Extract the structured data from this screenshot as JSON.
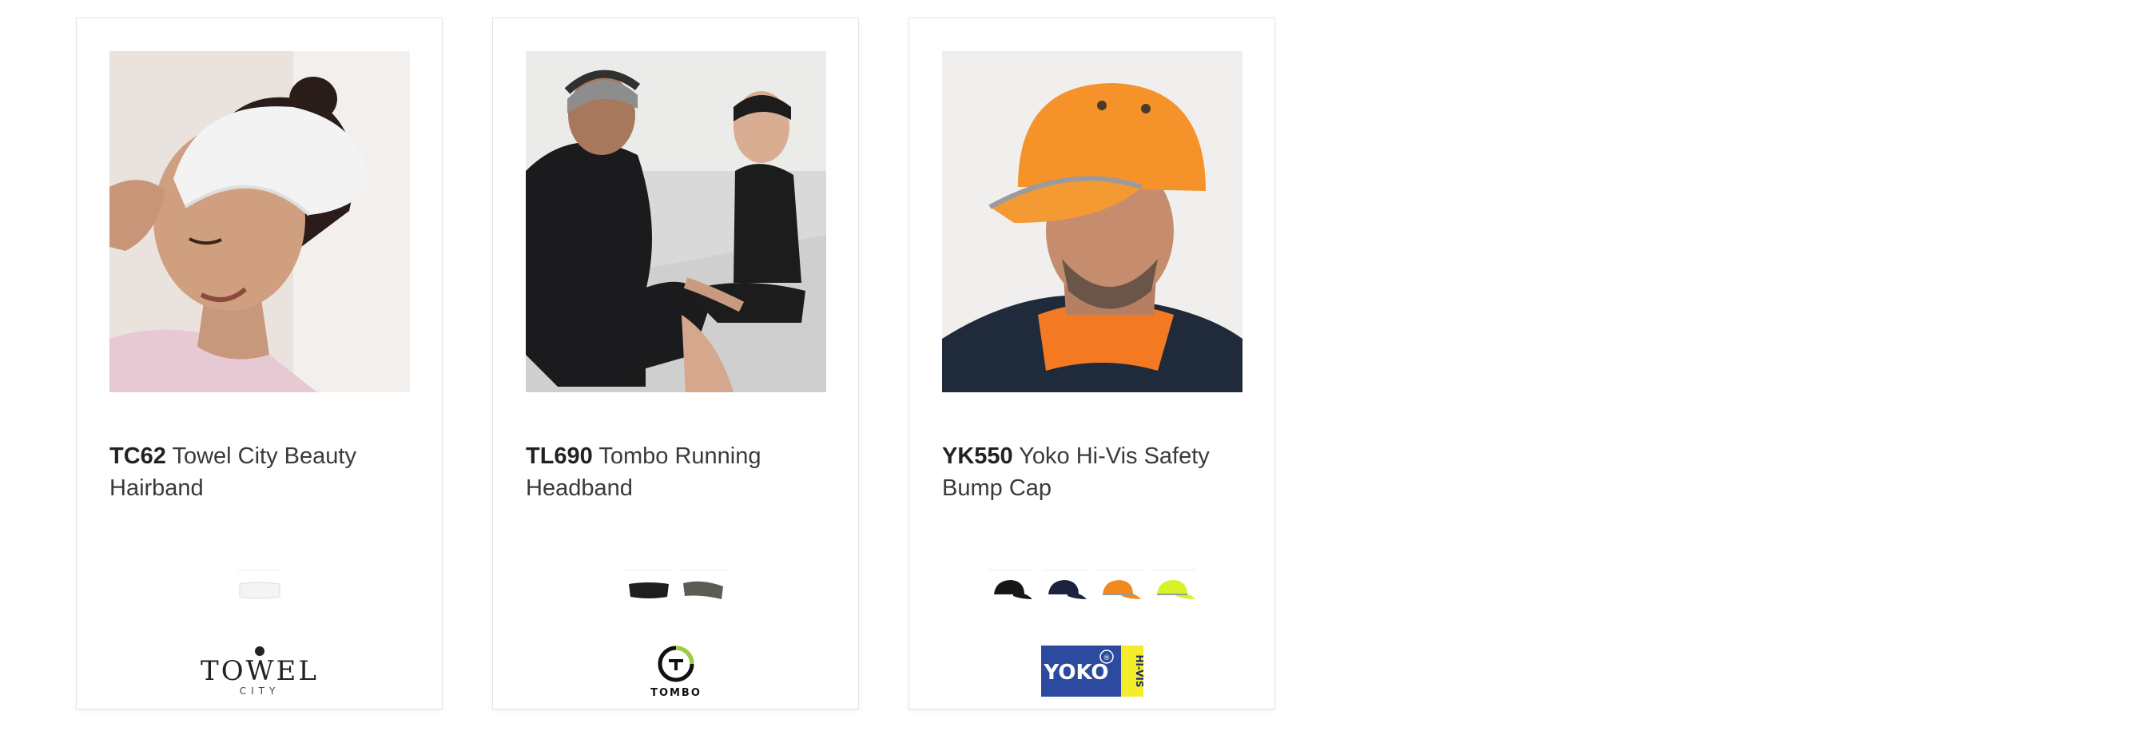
{
  "products": [
    {
      "code": "TC62",
      "name": "Towel City Beauty Hairband",
      "swatch_colors": [
        "#f4f4f4"
      ],
      "brand_logo": {
        "name": "towel-city-logo",
        "line1": "TOWEL",
        "line2": "CITY"
      }
    },
    {
      "code": "TL690",
      "name": "Tombo Running Headband",
      "swatch_colors": [
        "#1e1e1e",
        "#5b5d55"
      ],
      "brand_logo": {
        "name": "tombo-logo",
        "text": "TOMBO"
      }
    },
    {
      "code": "YK550",
      "name": "Yoko Hi-Vis Safety Bump Cap",
      "swatch_colors": [
        "#161616",
        "#1b2340",
        "#f08a1c",
        "#d8f229"
      ],
      "brand_logo": {
        "name": "yoko-hi-vis-logo",
        "text": "YOKO",
        "side_text": "HI-VIS",
        "badge": "®"
      }
    }
  ]
}
